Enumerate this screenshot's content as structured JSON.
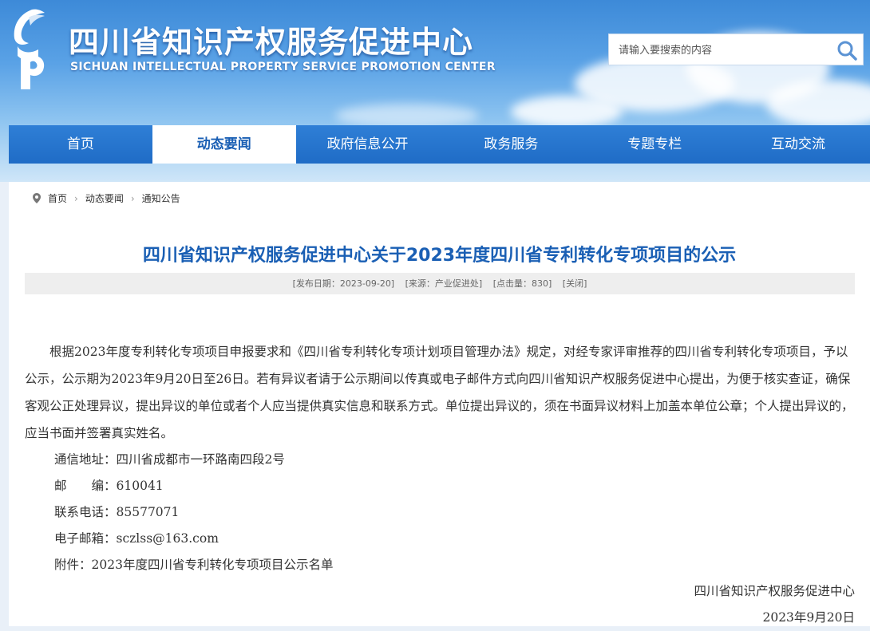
{
  "header": {
    "title": "四川省知识产权服务促进中心",
    "subtitle": "SICHUAN INTELLECTUAL PROPERTY SERVICE PROMOTION CENTER",
    "logo_icon": "cipp-logo-icon"
  },
  "search": {
    "placeholder": "请输入要搜索的内容",
    "icon": "search-icon"
  },
  "nav": {
    "items": [
      {
        "label": "首页"
      },
      {
        "label": "动态要闻"
      },
      {
        "label": "政府信息公开"
      },
      {
        "label": "政务服务"
      },
      {
        "label": "专题专栏"
      },
      {
        "label": "互动交流"
      }
    ],
    "active": "动态要闻"
  },
  "breadcrumb": {
    "items": [
      "首页",
      "动态要闻",
      "通知公告"
    ],
    "separator": "›"
  },
  "article": {
    "title": "四川省知识产权服务促进中心关于2023年度四川省专利转化专项项目的公示",
    "meta": {
      "date": "[发布日期：2023-09-20]",
      "source": "[来源：产业促进处]",
      "clicks": "[点击量：830]",
      "close": "[关闭]"
    },
    "paragraph": "根据2023年度专利转化专项项目申报要求和《四川省专利转化专项计划项目管理办法》规定，对经专家评审推荐的四川省专利转化专项项目，予以公示，公示期为2023年9月20日至26日。若有异议者请于公示期间以传真或电子邮件方式向四川省知识产权服务促进中心提出，为便于核实查证，确保客观公正处理异议，提出异议的单位或者个人应当提供真实信息和联系方式。单位提出异议的，须在书面异议材料上加盖本单位公章；个人提出异议的，应当书面并签署真实姓名。",
    "address": "通信地址：四川省成都市一环路南四段2号",
    "postcode": "邮　　编：610041",
    "phone": "联系电话：85577071",
    "email": "电子邮箱：sczlss@163.com",
    "attachment": "附件：2023年度四川省专利转化专项项目公示名单",
    "signature": "四川省知识产权服务促进中心",
    "sign_date": "2023年9月20日"
  },
  "colors": {
    "brand_blue": "#1a5fb4",
    "nav_blue": "#2a78d2"
  }
}
